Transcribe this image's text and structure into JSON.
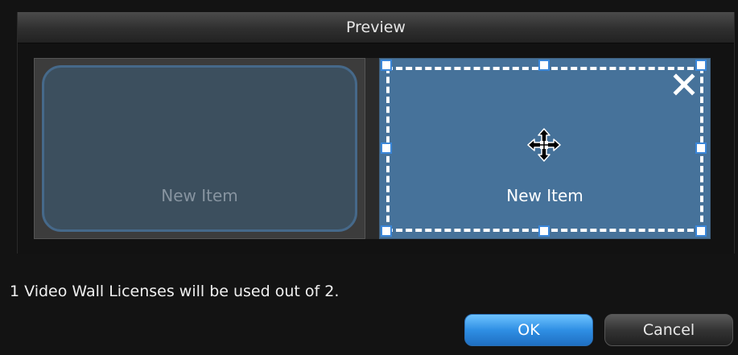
{
  "preview": {
    "title": "Preview"
  },
  "tiles": [
    {
      "label": "New Item",
      "state": "unselected"
    },
    {
      "label": "New Item",
      "state": "selected"
    }
  ],
  "status": {
    "license_text": "1 Video Wall Licenses will be used out of 2."
  },
  "buttons": {
    "ok_label": "OK",
    "cancel_label": "Cancel"
  },
  "icons": {
    "close": "close-icon",
    "move": "move-cursor-icon"
  },
  "colors": {
    "selected_tile": "#46729a",
    "unselected_tile": "#3c4f5e",
    "handle_border": "#3a86d8",
    "ok_button": "#2f8fe4"
  }
}
